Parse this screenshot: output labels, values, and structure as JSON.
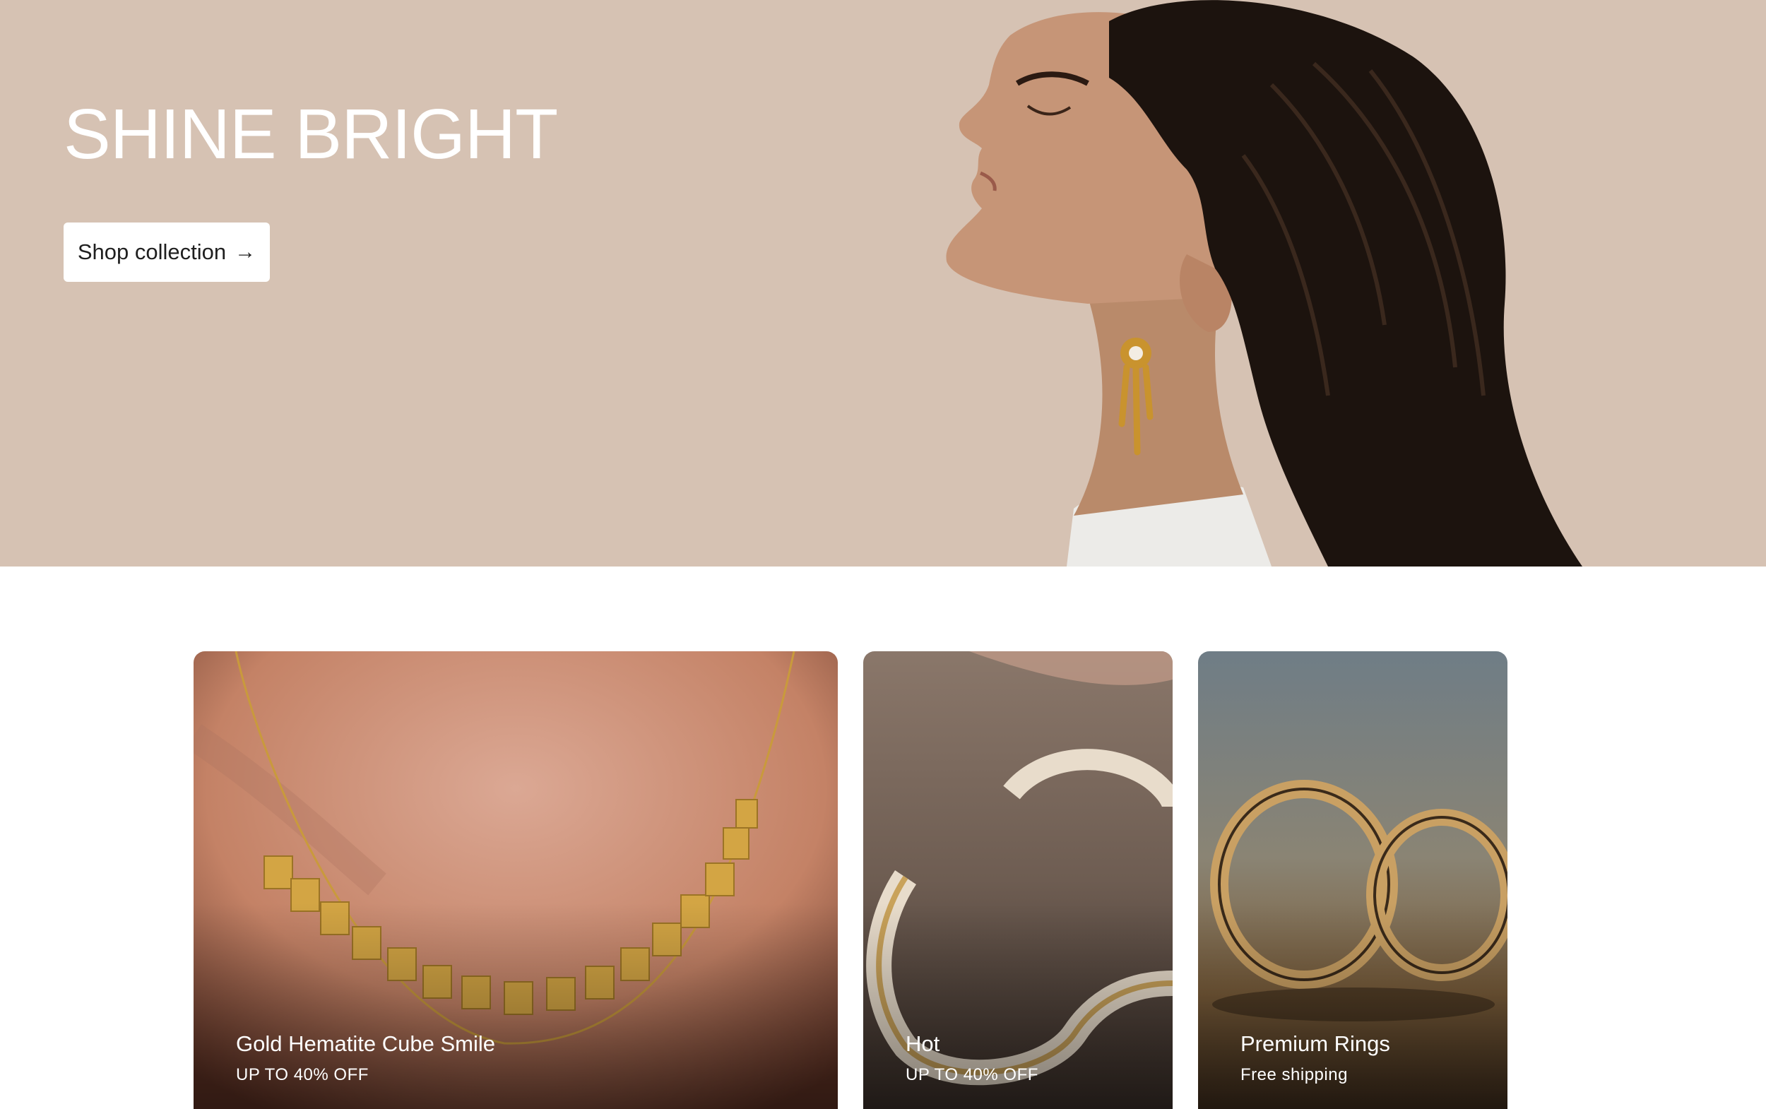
{
  "hero": {
    "title": "SHINE BRIGHT",
    "button_label": "Shop collection",
    "button_arrow": "→",
    "background_color": "#d6c2b3"
  },
  "cards": [
    {
      "title": "Gold Hematite Cube Smile",
      "subtitle": "UP TO 40% OFF"
    },
    {
      "title": "Hot",
      "subtitle": "UP TO 40% OFF"
    },
    {
      "title": "Premium Rings",
      "subtitle": "Free shipping"
    }
  ]
}
